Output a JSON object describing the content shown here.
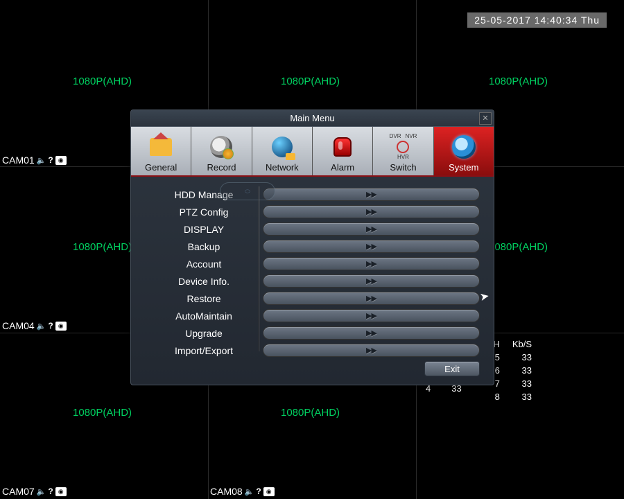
{
  "timestamp": "25-05-2017 14:40:34 Thu",
  "cam_res_label": "1080P(AHD)",
  "cams": [
    "CAM01",
    "CAM04",
    "CAM07",
    "CAM08"
  ],
  "stats": {
    "header": [
      "H",
      "Kb/S"
    ],
    "rows": [
      [
        "5",
        "33"
      ],
      [
        "6",
        "33"
      ],
      [
        "7",
        "33"
      ],
      [
        "8",
        "33"
      ]
    ],
    "extra_left": [
      "4",
      "33"
    ]
  },
  "dialog": {
    "title": "Main Menu",
    "tabs": [
      "General",
      "Record",
      "Network",
      "Alarm",
      "Switch",
      "System"
    ],
    "switch_labels": [
      "DVR",
      "NVR",
      "HVR"
    ],
    "items": [
      "HDD Manage",
      "PTZ Config",
      "DISPLAY",
      "Backup",
      "Account",
      "Device Info.",
      "Restore",
      "AutoMaintain",
      "Upgrade",
      "Import/Export"
    ],
    "exit": "Exit"
  }
}
